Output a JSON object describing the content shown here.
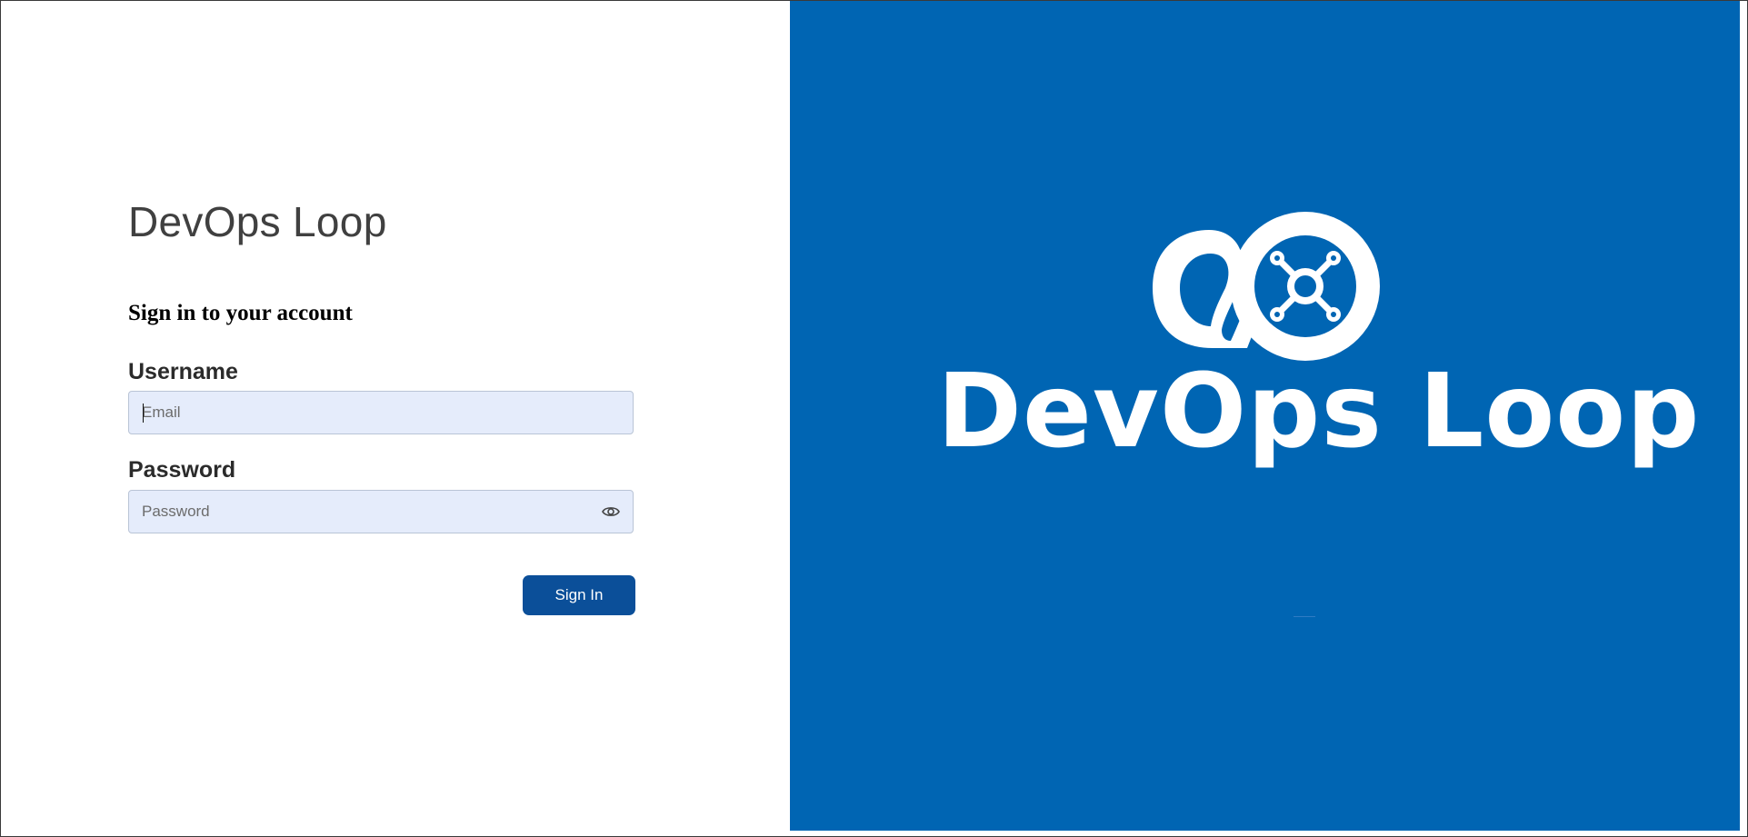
{
  "login": {
    "brand_title": "DevOps Loop",
    "subtitle": "Sign in to your account",
    "username_label": "Username",
    "username_placeholder": "Email",
    "username_value": "",
    "password_label": "Password",
    "password_placeholder": "Password",
    "password_value": "",
    "signin_label": "Sign In",
    "show_password_icon": "eye-icon"
  },
  "brand_panel": {
    "logo_text": "DevOps Loop",
    "logo_icon": "infinity-network-logo",
    "background": "#0065b3"
  },
  "colors": {
    "accent": "#0b4f99",
    "input_bg": "#e5ecfb",
    "brand_blue": "#0065b3"
  }
}
